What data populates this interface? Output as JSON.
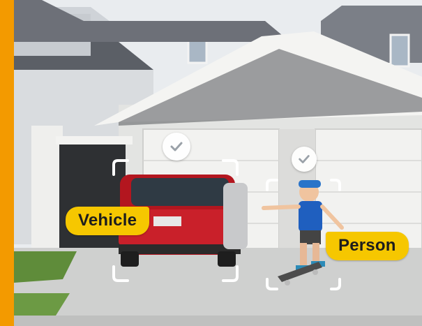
{
  "labels": {
    "vehicle": "Vehicle",
    "person": "Person"
  },
  "icons": {
    "vehicle_check": "checkmark-icon",
    "person_check": "checkmark-icon"
  },
  "colors": {
    "accent": "#F39A00",
    "tag": "#F6C700",
    "bracket": "#ffffff"
  }
}
